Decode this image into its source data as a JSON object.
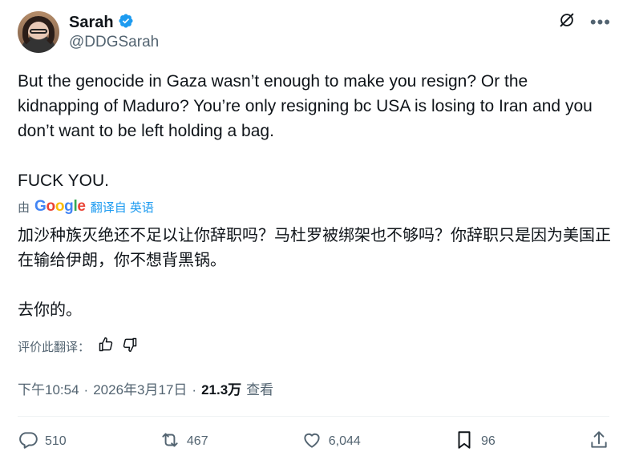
{
  "author": {
    "name": "Sarah",
    "handle": "@DDGSarah",
    "verified": true
  },
  "post": {
    "text": "But the genocide in Gaza wasn’t enough to make you resign? Or the kidnapping of Maduro? You’re only resigning bc USA is losing to Iran and you don’t want to be left holding a bag.\n\nFUCK YOU.",
    "translation_prefix": "由",
    "translation_provider": "Google",
    "translation_link": "翻译自 英语",
    "translated_text": "加沙种族灭绝还不足以让你辞职吗？马杜罗被绑架也不够吗？你辞职只是因为美国正在输给伊朗，你不想背黑锅。\n\n去你的。",
    "rate_label": "评价此翻译："
  },
  "meta": {
    "time": "下午10:54",
    "separator1": "·",
    "date": "2026年3月17日",
    "separator2": "·",
    "views": "21.3万",
    "views_label": "查看"
  },
  "actions": {
    "replies": "510",
    "reposts": "467",
    "likes": "6,044",
    "bookmarks": "96"
  },
  "colors": {
    "accent": "#1d9bf0",
    "muted": "#536471",
    "text": "#0f1419"
  }
}
